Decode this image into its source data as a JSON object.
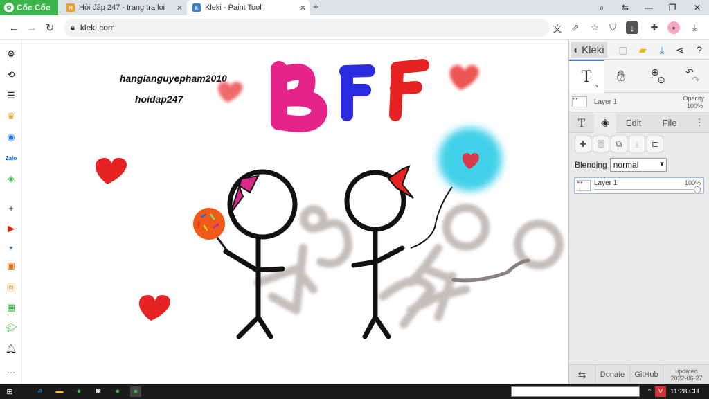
{
  "browser": {
    "brand": "Cốc Cốc",
    "tabs": [
      {
        "title": "Hỏi đáp 247 - trang tra loi",
        "active": false
      },
      {
        "title": "Kleki - Paint Tool",
        "active": true
      }
    ],
    "url": "kleki.com"
  },
  "canvas": {
    "username": "hangianguyepham2010",
    "site": "hoidap247",
    "letters": [
      "B",
      "F",
      "F"
    ]
  },
  "kleki": {
    "title": "Kleki",
    "layer_name": "Layer 1",
    "opacity_label": "Opacity",
    "opacity_value": "100%",
    "tabs": [
      "Edit",
      "File"
    ],
    "blending_label": "Blending",
    "blending_value": "normal",
    "layers": [
      {
        "name": "Layer 1",
        "opacity": "100%"
      }
    ],
    "footer": {
      "donate": "Donate",
      "github": "GitHub",
      "updated_label": "updated",
      "updated_date": "2022-06-27"
    }
  },
  "taskbar": {
    "clock": "11:28 CH"
  },
  "colors": {
    "accent_green": "#39b54a",
    "kleki_blue": "#3b7ddd",
    "pink": "#e6238a",
    "blue": "#2a2ae0",
    "red": "#e62222"
  }
}
